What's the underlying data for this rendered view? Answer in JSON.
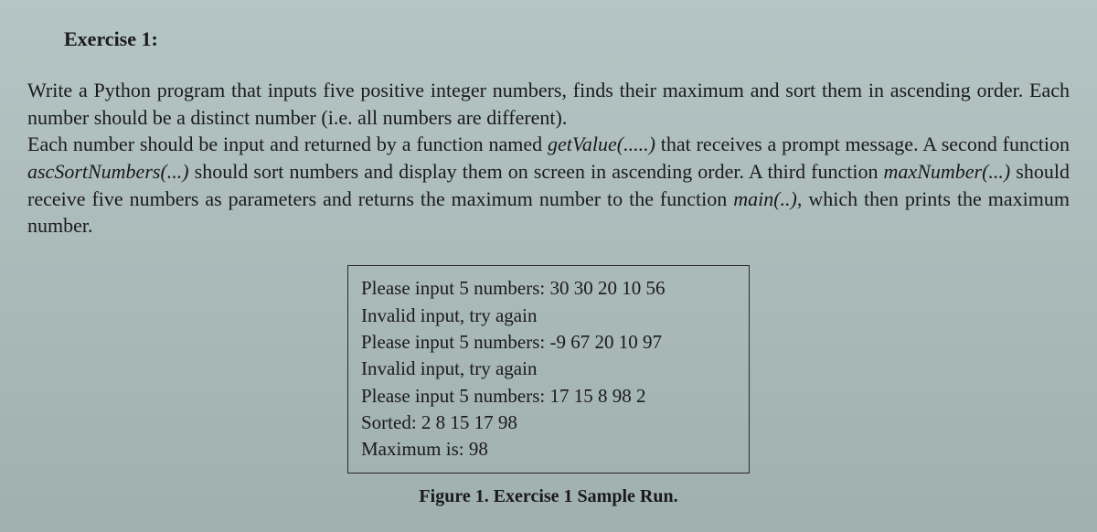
{
  "title": "Exercise 1:",
  "paragraph": {
    "p1": "Write a Python program that inputs five positive integer numbers, finds their maximum and sort them in ascending order. Each number should be a distinct number (i.e. all numbers are different).",
    "p2a": "Each number should be input and returned by a function named ",
    "fn1": "getValue(.....)",
    "p2b": " that receives a prompt message. A second function ",
    "fn2": "ascSortNumbers(...)",
    "p2c": " should sort numbers and display them on screen in ascending order. A third function ",
    "fn3": "maxNumber(...)",
    "p2d": " should receive five numbers as parameters and returns the maximum number to the function ",
    "fn4": "main(..)",
    "p2e": ", which then prints the maximum number."
  },
  "sample": {
    "lines": [
      "Please input 5 numbers: 30 30 20 10 56",
      "Invalid input, try again",
      "Please input 5 numbers: -9 67 20 10 97",
      "Invalid input, try again",
      "Please input 5 numbers: 17 15 8 98 2",
      "Sorted: 2 8 15 17 98",
      "Maximum is: 98"
    ]
  },
  "figure_caption": "Figure 1. Exercise 1 Sample Run."
}
